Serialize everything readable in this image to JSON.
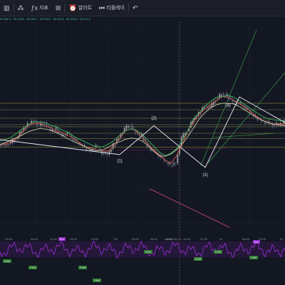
{
  "toolbar": {
    "items": [
      {
        "icon": "candle-icon",
        "label": ""
      },
      {
        "icon": "dots-icon",
        "label": ""
      },
      {
        "icon": "indicator-fx-icon",
        "label": "지표"
      },
      {
        "icon": "grid-icon",
        "label": ""
      },
      {
        "icon": "replay-icon",
        "label": "알러트"
      },
      {
        "icon": "play-replay-icon",
        "label": "리플레이"
      },
      {
        "icon": "undo-icon",
        "label": ""
      }
    ]
  },
  "legend": {
    "values": [
      "91.562.4",
      "93.748.6",
      "93.190.2",
      "93.203.0",
      "96.413.0",
      "92.976.8",
      "90.474.2"
    ]
  },
  "colors": {
    "background": "#131722",
    "wave": "#e8e8f0",
    "ma_red": "#d9534f",
    "ma_tan": "#cfc7a4",
    "ma_green": "#41b35e",
    "level_yellow": "#c8b23a",
    "channel_green": "#3fa84f",
    "trend_red": "#d94a6e",
    "oscillator": "#9b30d9"
  },
  "chart_data": {
    "type": "line",
    "x": [
      0,
      2,
      4,
      6,
      8,
      10,
      12,
      14,
      16,
      18,
      20,
      22,
      24,
      26,
      28,
      30,
      32,
      34,
      36,
      38,
      40,
      42,
      44,
      46,
      48,
      50,
      52,
      54,
      56,
      58,
      60,
      62,
      64,
      66,
      68,
      70,
      72,
      74,
      76,
      78,
      80,
      82,
      84,
      86,
      88,
      90,
      92,
      94,
      96,
      98,
      100
    ],
    "series": [
      {
        "values": [
          50,
          49,
          51,
          55,
          62,
          68,
          72,
          67,
          70,
          62,
          64,
          58,
          60,
          55,
          50,
          47,
          44,
          48,
          42,
          40,
          48,
          56,
          64,
          68,
          60,
          58,
          48,
          44,
          40,
          34,
          30,
          32,
          56,
          62,
          72,
          78,
          86,
          84,
          92,
          96,
          95,
          90,
          88,
          85,
          80,
          75,
          72,
          70,
          68,
          68,
          70
        ]
      }
    ],
    "levels": [
      88,
      82,
      74,
      68,
      66,
      60,
      55,
      47
    ],
    "wave_labels": [
      "(2)",
      "(1)",
      "(1)",
      "(4)"
    ],
    "x_ticks": [
      "19:00",
      "20:00",
      "21:00",
      "22:00",
      "23:00",
      "'25",
      "03:00",
      "05:00",
      "06:00",
      "2025-05-13 · 11:00",
      "07:30",
      "14",
      "06:00",
      "07:00",
      "12"
    ],
    "oscillator": {
      "badges_top": [
        "Bear",
        "Bear"
      ],
      "badges_bottom": [
        "H Bull",
        "H Bull",
        "H Bull",
        "H Bull",
        "H Bull",
        "H Bull",
        "H Bull",
        "H Bull"
      ]
    }
  }
}
